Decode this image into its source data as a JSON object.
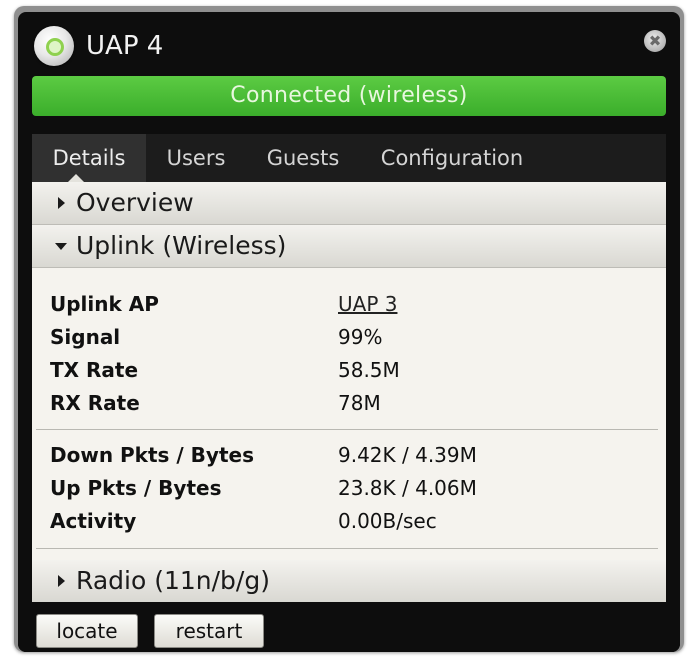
{
  "window": {
    "title": "UAP 4",
    "close_glyph": "✖",
    "status": "Connected (wireless)",
    "status_color": "#4cbb38"
  },
  "tabs": [
    {
      "label": "Details",
      "active": true
    },
    {
      "label": "Users",
      "active": false
    },
    {
      "label": "Guests",
      "active": false
    },
    {
      "label": "Configuration",
      "active": false
    }
  ],
  "sections": {
    "overview": {
      "label": "Overview",
      "expanded": false
    },
    "uplink": {
      "label": "Uplink (Wireless)",
      "expanded": true
    },
    "radio": {
      "label": "Radio (11n/b/g)",
      "expanded": false
    }
  },
  "uplink_details": {
    "uplink_ap": {
      "label": "Uplink AP",
      "value": "UAP 3"
    },
    "signal": {
      "label": "Signal",
      "value": "99%"
    },
    "tx_rate": {
      "label": "TX Rate",
      "value": "58.5M"
    },
    "rx_rate": {
      "label": "RX Rate",
      "value": "78M"
    },
    "down": {
      "label": "Down Pkts / Bytes",
      "value": "9.42K / 4.39M"
    },
    "up": {
      "label": "Up Pkts / Bytes",
      "value": "23.8K / 4.06M"
    },
    "activity": {
      "label": "Activity",
      "value": "0.00B/sec"
    }
  },
  "buttons": {
    "locate": "locate",
    "restart": "restart"
  }
}
